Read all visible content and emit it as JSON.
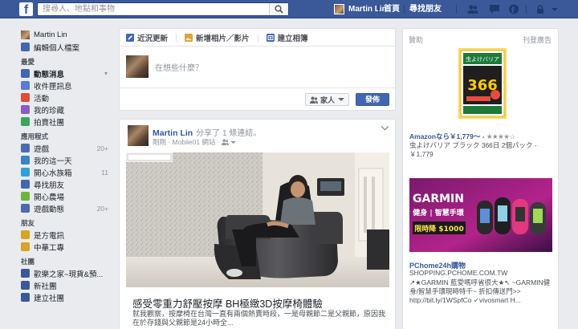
{
  "topbar": {
    "logo": "f",
    "search_placeholder": "搜尋人、地點和事物",
    "user_name": "Martin Lin",
    "home": "首頁",
    "find_friends": "尋找朋友"
  },
  "sidebar": {
    "profile_name": "Martin Lin",
    "edit_profile": "編輯個人檔案",
    "sections": [
      {
        "header": "最愛",
        "items": [
          {
            "label": "動態消息",
            "count": "",
            "color": "#4267b2",
            "active": true
          },
          {
            "label": "收件匣訊息",
            "count": "",
            "color": "#5b7bd5"
          },
          {
            "label": "活動",
            "count": "",
            "color": "#e04b3a"
          },
          {
            "label": "我的珍藏",
            "count": "",
            "color": "#8b5bc9"
          },
          {
            "label": "拍賣社團",
            "count": "",
            "color": "#3aa55d"
          }
        ]
      },
      {
        "header": "應用程式",
        "items": [
          {
            "label": "遊戲",
            "count": "20+",
            "color": "#4a6bb0"
          },
          {
            "label": "我的這一天",
            "count": "",
            "color": "#3b82c4"
          },
          {
            "label": "開心水族箱",
            "count": "11",
            "color": "#2aa3d8"
          },
          {
            "label": "尋找朋友",
            "count": "",
            "color": "#4267b2"
          },
          {
            "label": "開心農場",
            "count": "",
            "color": "#6fb33d"
          },
          {
            "label": "遊戲動態",
            "count": "20+",
            "color": "#4a6bb0"
          }
        ]
      },
      {
        "header": "朋友",
        "items": [
          {
            "label": "是方電訊",
            "count": "",
            "color": "#d9a426"
          },
          {
            "label": "中華工專",
            "count": "",
            "color": "#d9a426"
          }
        ]
      },
      {
        "header": "社團",
        "items": [
          {
            "label": "歡樂之家~現貨&預...",
            "count": "",
            "color": "#3b5998"
          },
          {
            "label": "新社團",
            "count": "",
            "color": "#3b5998"
          },
          {
            "label": "建立社團",
            "count": "",
            "color": "#3b5998"
          }
        ]
      }
    ]
  },
  "composer": {
    "tab_status": "近況更新",
    "tab_photo": "新增相片／影片",
    "tab_album": "建立相簿",
    "placeholder": "在想些什麼？",
    "audience": "家人",
    "post_button": "發佈"
  },
  "post": {
    "author": "Martin Lin",
    "action": "分享了 1 條連結。",
    "meta": "剛剛 · Mobile01 網站 · ",
    "link_title": "感受零重力舒壓按摩 BH極緻3D按摩椅體驗",
    "link_desc": "就我觀察，按摩椅在台灣一直有兩個熱賣時段，一是母親節二是父親節，原因我在於存錢與父親節是24小時全..."
  },
  "ads": {
    "header": "贊助",
    "create": "刊登廣告",
    "ad1_title": "Amazonなら￥1,779～ -",
    "ad1_stars": "★★★★☆",
    "ad1_desc": "虫よけバリア ブラック 366日 2個パック - ￥1,779",
    "ad1_product_text": "虫よけバリア",
    "ad1_product_number": "366",
    "ad2_title": "PChome24h購物",
    "ad2_domain": "SHOPPING.PCHOME.COM.TW",
    "ad2_desc": "↗★GARMIN 藍愛嗎呼省很大★↖ ~GARMIN健身/智慧手環現時特千~ 折扣傳送門>> http://bit.ly/1WSpfCo ✓vivosmart H...",
    "ad2_brand": "GARMIN",
    "ad2_tagline": "健身 | 智慧手環",
    "ad2_promo": "限時降 $1000"
  }
}
